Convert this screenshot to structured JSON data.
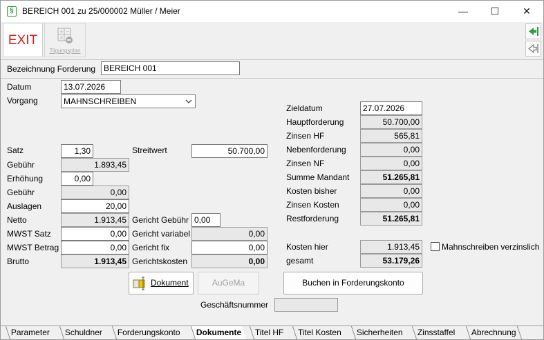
{
  "window": {
    "title": "BEREICH 001 zu 25/000002 Müller / Meier",
    "app_icon": "§",
    "minimize": "—",
    "maximize": "☐",
    "close": "✕"
  },
  "toolbar": {
    "exit_label": "EXIT",
    "tilgungsplan_label": "Tilgungsplan"
  },
  "header": {
    "bezeichnung_label": "Bezeichnung Forderung",
    "bezeichnung_value": "BEREICH 001"
  },
  "left": {
    "datum_label": "Datum",
    "datum_value": "13.07.2026",
    "vorgang_label": "Vorgang",
    "vorgang_value": "MAHNSCHREIBEN",
    "satz_label": "Satz",
    "satz_value": "1,30",
    "gebuehr_label": "Gebühr",
    "gebuehr_value": "1.893,45",
    "erhoehung_label": "Erhöhung",
    "erhoehung_value": "0,00",
    "gebuehr2_label": "Gebühr",
    "gebuehr2_value": "0,00",
    "auslagen_label": "Auslagen",
    "auslagen_value": "20,00",
    "netto_label": "Netto",
    "netto_value": "1.913,45",
    "mwst_satz_label": "MWST Satz",
    "mwst_satz_value": "0,00",
    "mwst_betrag_label": "MWST Betrag",
    "mwst_betrag_value": "0,00",
    "brutto_label": "Brutto",
    "brutto_value": "1.913,45"
  },
  "middle": {
    "streitwert_label": "Streitwert",
    "streitwert_value": "50.700,00",
    "gericht_gebuehr_label": "Gericht Gebühr",
    "gericht_gebuehr_value": "0,00",
    "gericht_variabel_label": "Gericht variabel",
    "gericht_variabel_value": "0,00",
    "gericht_fix_label": "Gericht fix",
    "gericht_fix_value": "0,00",
    "gerichtskosten_label": "Gerichtskosten",
    "gerichtskosten_value": "0,00"
  },
  "right": {
    "zieldatum_label": "Zieldatum",
    "zieldatum_value": "27.07.2026",
    "hauptforderung_label": "Hauptforderung",
    "hauptforderung_value": "50.700,00",
    "zinsen_hf_label": "Zinsen HF",
    "zinsen_hf_value": "565,81",
    "nebenforderung_label": "Nebenforderung",
    "nebenforderung_value": "0,00",
    "zinsen_nf_label": "Zinsen NF",
    "zinsen_nf_value": "0,00",
    "summe_mandant_label": "Summe Mandant",
    "summe_mandant_value": "51.265,81",
    "kosten_bisher_label": "Kosten bisher",
    "kosten_bisher_value": "0,00",
    "zinsen_kosten_label": "Zinsen Kosten",
    "zinsen_kosten_value": "0,00",
    "restforderung_label": "Restforderung",
    "restforderung_value": "51.265,81",
    "kosten_hier_label": "Kosten hier",
    "kosten_hier_value": "1.913,45",
    "gesamt_label": "gesamt",
    "gesamt_value": "53.179,26",
    "mahnschreiben_verzinslich_label": "Mahnschreiben verzinslich",
    "mahnschreiben_verzinslich_checked": false
  },
  "buttons": {
    "dokument_label": "Dokument",
    "augema_label": "AuGeMa",
    "buchen_label": "Buchen in Forderungskonto",
    "geschaeftsnummer_label": "Geschäftsnummer",
    "geschaeftsnummer_value": ""
  },
  "tabs": [
    {
      "label": "Parameter",
      "active": false
    },
    {
      "label": "Schuldner",
      "active": false
    },
    {
      "label": "Forderungskonto",
      "active": false
    },
    {
      "label": "Dokumente",
      "active": true
    },
    {
      "label": "Titel HF",
      "active": false
    },
    {
      "label": "Titel Kosten",
      "active": false
    },
    {
      "label": "Sicherheiten",
      "active": false
    },
    {
      "label": "Zinsstaffel",
      "active": false
    },
    {
      "label": "Abrechnung",
      "active": false
    }
  ],
  "colors": {
    "exit_red": "#d32020",
    "accent_green": "#2e9e3e",
    "readonly_bg": "#e8e8e8",
    "doc_icon_yellow": "#f5c400"
  }
}
